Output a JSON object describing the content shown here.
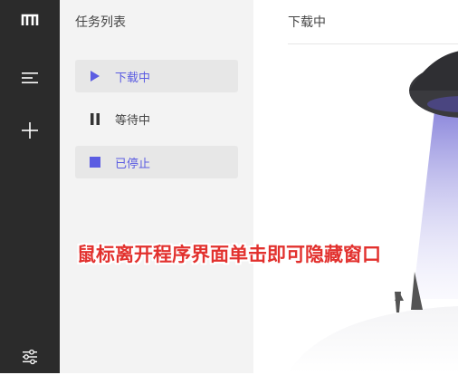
{
  "rail": {
    "icons": [
      "app-logo-icon",
      "menu-icon",
      "plus-icon",
      "settings-sliders-icon"
    ]
  },
  "sidebar": {
    "title": "任务列表",
    "items": [
      {
        "label": "下载中",
        "icon": "play-icon",
        "color": "#5b5ce2",
        "active": true
      },
      {
        "label": "等待中",
        "icon": "pause-icon",
        "color": "#444444",
        "active": false
      },
      {
        "label": "已停止",
        "icon": "stop-icon",
        "color": "#5b5ce2",
        "active": false
      }
    ]
  },
  "main": {
    "title": "下载中"
  },
  "caption": "鼠标离开程序界面单击即可隐藏窗口",
  "colors": {
    "rail": "#2b2b2b",
    "sidebar": "#f3f3f3",
    "accent": "#5b5ce2",
    "caption": "#e2312e"
  }
}
